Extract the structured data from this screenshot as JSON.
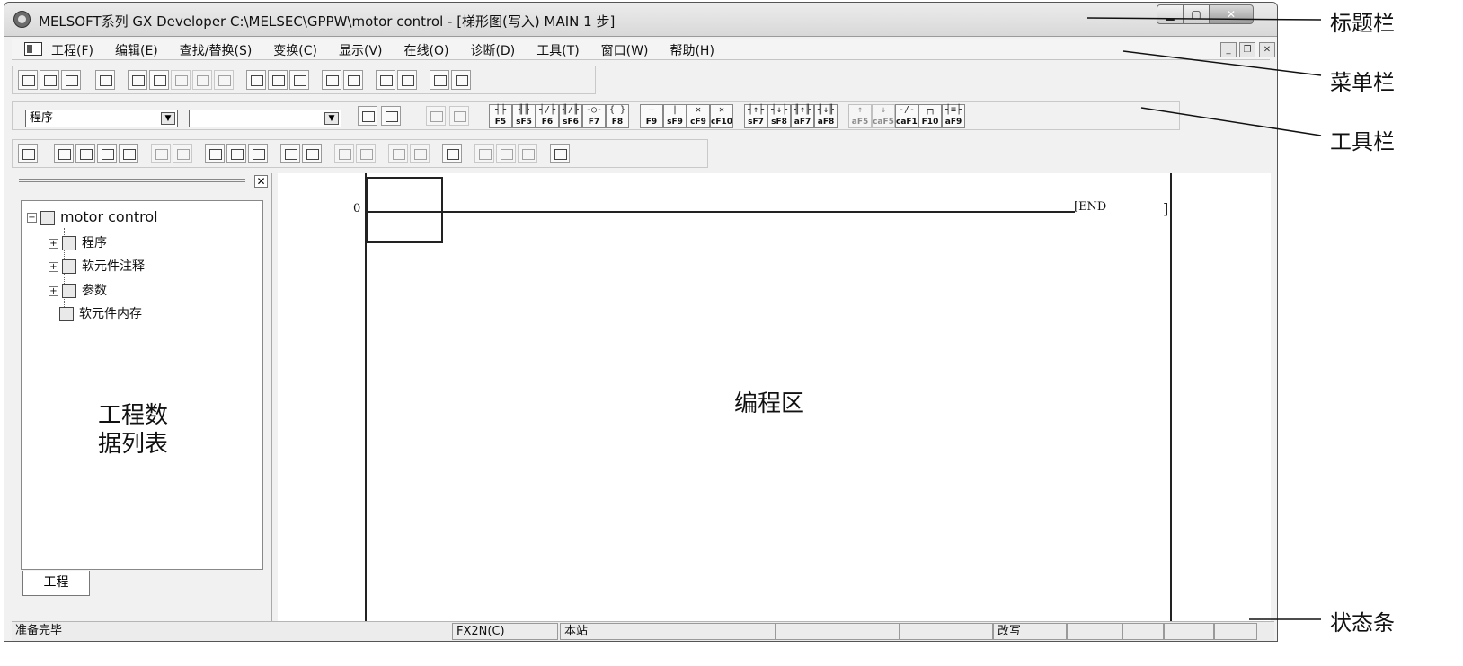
{
  "window": {
    "title": "MELSOFT系列 GX Developer C:\\MELSEC\\GPPW\\motor control - [梯形图(写入)     MAIN    1 步]"
  },
  "menu": {
    "items": [
      "工程(F)",
      "编辑(E)",
      "查找/替换(S)",
      "变换(C)",
      "显示(V)",
      "在线(O)",
      "诊断(D)",
      "工具(T)",
      "窗口(W)",
      "帮助(H)"
    ]
  },
  "toolbar": {
    "program_combo": "程序",
    "blank_combo": "",
    "fkeys": [
      {
        "sym": "┤├",
        "key": "F5"
      },
      {
        "sym": "╢╟",
        "key": "sF5"
      },
      {
        "sym": "┤/├",
        "key": "F6"
      },
      {
        "sym": "╢/╟",
        "key": "sF6"
      },
      {
        "sym": "-○-",
        "key": "F7"
      },
      {
        "sym": "{ }",
        "key": "F8"
      },
      {
        "sym": "—",
        "key": "F9"
      },
      {
        "sym": "|",
        "key": "sF9"
      },
      {
        "sym": "✕",
        "key": "cF9"
      },
      {
        "sym": "✕",
        "key": "cF10"
      },
      {
        "sym": "┤↑├",
        "key": "sF7"
      },
      {
        "sym": "┤↓├",
        "key": "sF8"
      },
      {
        "sym": "╢↑╟",
        "key": "aF7"
      },
      {
        "sym": "╢↓╟",
        "key": "aF8"
      },
      {
        "sym": "↑",
        "key": "aF5"
      },
      {
        "sym": "↓",
        "key": "caF5"
      },
      {
        "sym": "-/-",
        "key": "caF10"
      },
      {
        "sym": "┌┐",
        "key": "F10"
      },
      {
        "sym": "┤≡├",
        "key": "aF9"
      }
    ]
  },
  "project_tree": {
    "root": "motor control",
    "items": [
      "程序",
      "软元件注释",
      "参数",
      "软元件内存"
    ],
    "tab": "工程",
    "caption_line1": "工程数",
    "caption_line2": "据列表"
  },
  "ladder": {
    "step": "0",
    "end_instruction": "[END",
    "end_bracket": "]",
    "caption": "编程区"
  },
  "statusbar": {
    "ready": "准备完毕",
    "plc": "FX2N(C)",
    "station": "本站",
    "mode": "改写"
  },
  "annotations": {
    "title_bar": "标题栏",
    "menu_bar": "菜单栏",
    "tool_bar": "工具栏",
    "status_bar": "状态条"
  }
}
